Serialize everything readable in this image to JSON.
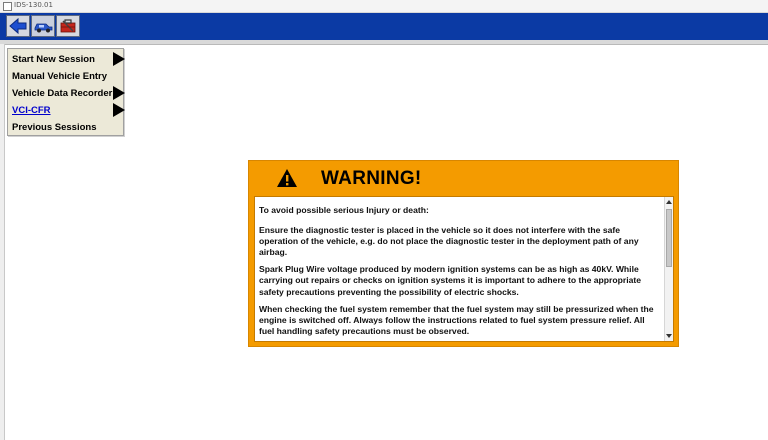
{
  "window": {
    "title": "IDS-130.01"
  },
  "toolbar": {
    "buttons": [
      {
        "icon": "back-arrow-icon"
      },
      {
        "icon": "vehicle-icon"
      },
      {
        "icon": "toolbox-icon"
      }
    ]
  },
  "menu": {
    "items": [
      {
        "label": "Start New Session",
        "has_submenu": true
      },
      {
        "label": "Manual Vehicle Entry",
        "has_submenu": false
      },
      {
        "label": "Vehicle Data Recorder",
        "has_submenu": true
      },
      {
        "label": "VCI-CFR",
        "has_submenu": true,
        "link": true
      },
      {
        "label": "Previous Sessions",
        "has_submenu": false
      }
    ]
  },
  "warning": {
    "title": "WARNING!",
    "intro": "To avoid possible serious Injury or death:",
    "paragraphs": [
      "Ensure the diagnostic tester is placed in the vehicle so it does not interfere with the safe operation of the vehicle, e.g. do not place the diagnostic tester in the deployment path of any airbag.",
      "Spark Plug Wire voltage produced by modern ignition systems can be as high as 40kV. While carrying out repairs or checks on ignition systems it is important to adhere to the appropriate safety precautions preventing the possibility of electric shocks.",
      "When checking the fuel system remember that the fuel system may still be pressurized when the engine is switched off. Always follow the instructions related to fuel system pressure relief. All fuel handling safety precautions must be observed."
    ]
  },
  "colors": {
    "toolbar_bg": "#0b3aa4",
    "warning_bg": "#f49b00",
    "menu_bg": "#ece9d8",
    "link": "#0000cc"
  }
}
